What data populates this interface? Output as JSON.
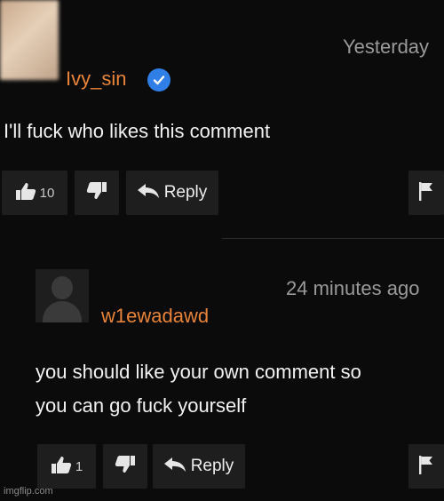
{
  "comments": [
    {
      "username": "Ivy_sin",
      "verified": true,
      "timestamp": "Yesterday",
      "text": "I'll fuck who likes this comment",
      "likes": "10",
      "reply_label": "Reply",
      "avatar": "blurred-photo"
    },
    {
      "username": "w1ewadawd",
      "verified": false,
      "timestamp": "24 minutes ago",
      "text_lines": [
        "you should like your own comment so",
        "you can go fuck yourself"
      ],
      "likes": "1",
      "reply_label": "Reply",
      "avatar": "default-silhouette"
    }
  ],
  "icons": [
    "thumbs-up-icon",
    "thumbs-down-icon",
    "reply-arrow-icon",
    "flag-icon",
    "verified-check-icon"
  ],
  "colors": {
    "background": "#0b0b0b",
    "username": "#e8843a",
    "verified": "#2f7fe6",
    "button": "#1e1e1e",
    "timestamp": "#9a9a9a"
  },
  "watermark": "imgflip.com"
}
